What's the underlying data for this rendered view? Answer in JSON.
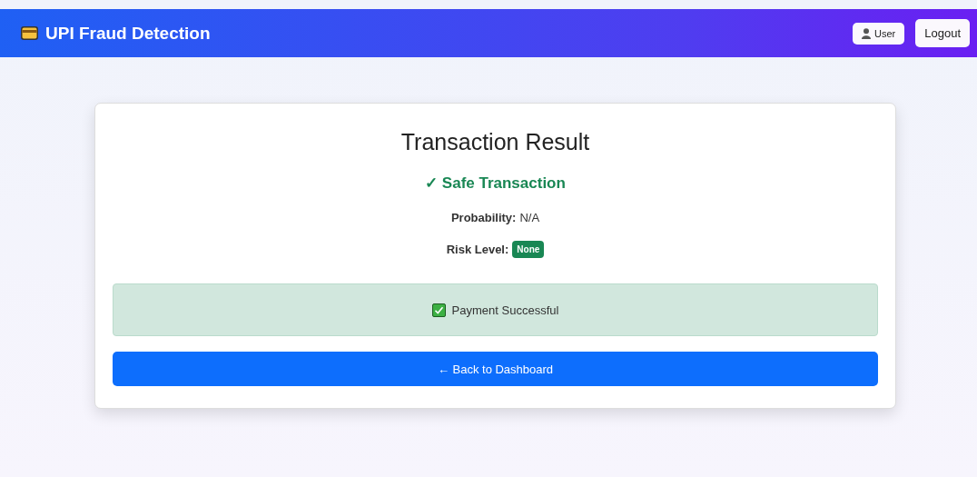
{
  "navbar": {
    "brand": "UPI Fraud Detection",
    "user_button": "User",
    "logout_button": "Logout"
  },
  "card": {
    "title": "Transaction Result",
    "result": {
      "kind": "safe",
      "text": "✓ Safe Transaction"
    },
    "details": [
      {
        "label": "Probability:",
        "value": "N/A"
      }
    ],
    "risk": {
      "label": "Risk Level:",
      "badge": "None",
      "color": "#198754"
    },
    "alert": {
      "kind": "success",
      "text": "Payment Successful"
    },
    "back_button": "← Back to Dashboard"
  }
}
